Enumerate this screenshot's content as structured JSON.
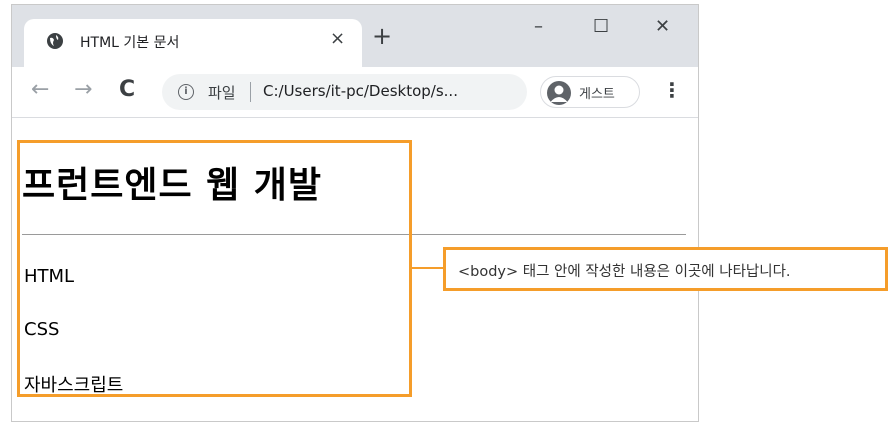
{
  "browser": {
    "tab": {
      "title": "HTML 기본 문서",
      "close_glyph": "×",
      "favicon": "globe-icon"
    },
    "new_tab_glyph": "+",
    "window_controls": {
      "minimize": "–",
      "maximize": "☐",
      "close": "✕"
    },
    "nav": {
      "back": "←",
      "forward": "→",
      "reload": "C"
    },
    "address": {
      "info_glyph": "i",
      "scheme_label": "파일",
      "url": "C:/Users/it-pc/Desktop/s..."
    },
    "profile": {
      "label": "게스트"
    },
    "menu_glyph": "⋮"
  },
  "page": {
    "heading": "프런트엔드 웹 개발",
    "items": [
      "HTML",
      "CSS",
      "자바스크립트"
    ]
  },
  "annotation": {
    "callout_text": "<body> 태그 안에 작성한 내용은 이곳에 나타납니다.",
    "color": "#f59d2a"
  },
  "colors": {
    "tabstrip": "#dee1e6",
    "omnibox": "#f1f3f4",
    "accent": "#f59d2a"
  }
}
